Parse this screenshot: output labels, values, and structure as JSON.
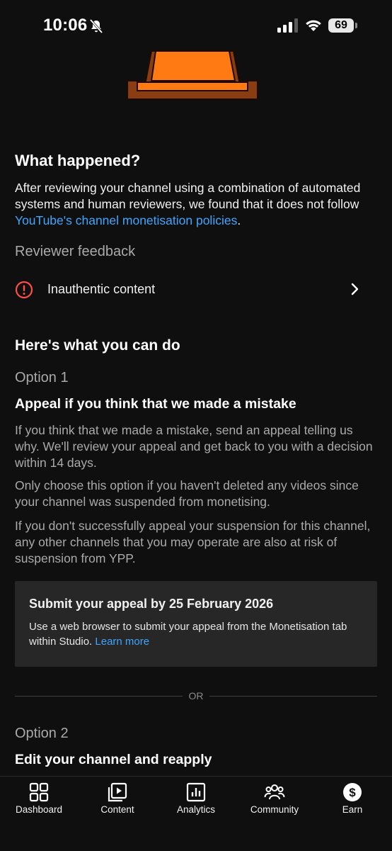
{
  "status_bar": {
    "time": "10:06",
    "battery": "69"
  },
  "what_happened": {
    "title": "What happened?",
    "body_prefix": "After reviewing your channel using a combination of automated systems and human reviewers, we found that it does not follow ",
    "policy_link": "YouTube's channel monetisation policies",
    "body_suffix": "."
  },
  "reviewer_feedback": {
    "title": "Reviewer feedback",
    "items": [
      {
        "label": "Inauthentic content",
        "icon": "alert-circle-icon"
      }
    ]
  },
  "what_you_can_do": {
    "title": "Here's what you can do",
    "option1": {
      "label": "Option 1",
      "title": "Appeal if you think that we made a mistake",
      "paragraphs": [
        "If you think that we made a mistake, send an appeal telling us why. We'll review your appeal and get back to you with a decision within 14 days.",
        "Only choose this option if you haven't deleted any videos since your channel was suspended from monetising.",
        "If you don't successfully appeal your suspension for this channel, any other channels that you may operate are also at risk of suspension from YPP."
      ],
      "notice": {
        "title": "Submit your appeal by 25 February 2026",
        "text": "Use a web browser to submit your appeal from the Monetisation tab within Studio. ",
        "link": "Learn more"
      }
    },
    "divider_label": "OR",
    "option2": {
      "label": "Option 2",
      "title": "Edit your channel and reapply"
    }
  },
  "bottom_nav": {
    "items": [
      {
        "label": "Dashboard",
        "icon": "dashboard-icon"
      },
      {
        "label": "Content",
        "icon": "content-icon"
      },
      {
        "label": "Analytics",
        "icon": "analytics-icon"
      },
      {
        "label": "Community",
        "icon": "community-icon"
      },
      {
        "label": "Earn",
        "icon": "earn-icon"
      }
    ]
  },
  "colors": {
    "background": "#0f0f0f",
    "link": "#3ea6ff",
    "alert": "#ff4e45",
    "notice_bg": "#272727",
    "illustration_orange": "#ff7a12",
    "illustration_brown": "#8b3d12"
  }
}
